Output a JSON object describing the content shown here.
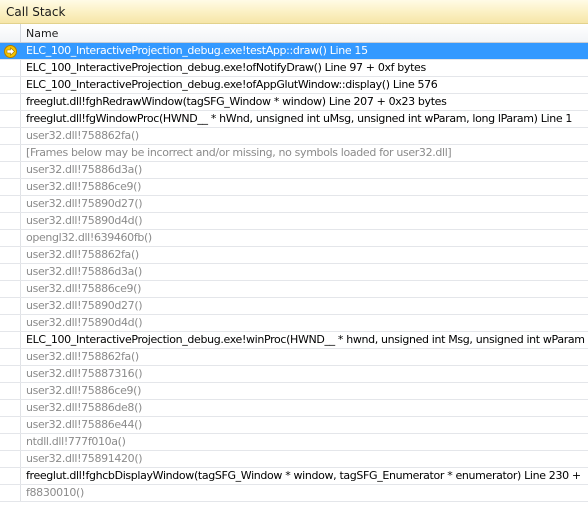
{
  "panel": {
    "title": "Call Stack"
  },
  "columns": {
    "name": "Name"
  },
  "icons": {
    "current_frame": "current-frame-arrow-icon"
  },
  "colors": {
    "selection": "#3399ff",
    "user_code": "#000000",
    "external_code": "#8b8b8b"
  },
  "frames": [
    {
      "text": "ELC_100_InteractiveProjection_debug.exe!testApp::draw()  Line 15",
      "kind": "user",
      "current": true
    },
    {
      "text": "ELC_100_InteractiveProjection_debug.exe!ofNotifyDraw()  Line 97 + 0xf bytes",
      "kind": "user",
      "current": false
    },
    {
      "text": "ELC_100_InteractiveProjection_debug.exe!ofAppGlutWindow::display()  Line 576",
      "kind": "user",
      "current": false
    },
    {
      "text": "freeglut.dll!fghRedrawWindow(tagSFG_Window * window)  Line 207 + 0x23 bytes",
      "kind": "user",
      "current": false
    },
    {
      "text": "freeglut.dll!fgWindowProc(HWND__ * hWnd, unsigned int uMsg, unsigned int wParam, long lParam)  Line 1",
      "kind": "user",
      "current": false
    },
    {
      "text": "user32.dll!758862fa()",
      "kind": "external",
      "current": false
    },
    {
      "text": "[Frames below may be incorrect and/or missing, no symbols loaded for user32.dll]",
      "kind": "external",
      "current": false
    },
    {
      "text": "user32.dll!75886d3a()",
      "kind": "external",
      "current": false
    },
    {
      "text": "user32.dll!75886ce9()",
      "kind": "external",
      "current": false
    },
    {
      "text": "user32.dll!75890d27()",
      "kind": "external",
      "current": false
    },
    {
      "text": "user32.dll!75890d4d()",
      "kind": "external",
      "current": false
    },
    {
      "text": "opengl32.dll!639460fb()",
      "kind": "external",
      "current": false
    },
    {
      "text": "user32.dll!758862fa()",
      "kind": "external",
      "current": false
    },
    {
      "text": "user32.dll!75886d3a()",
      "kind": "external",
      "current": false
    },
    {
      "text": "user32.dll!75886ce9()",
      "kind": "external",
      "current": false
    },
    {
      "text": "user32.dll!75890d27()",
      "kind": "external",
      "current": false
    },
    {
      "text": "user32.dll!75890d4d()",
      "kind": "external",
      "current": false
    },
    {
      "text": "ELC_100_InteractiveProjection_debug.exe!winProc(HWND__ * hwnd, unsigned int Msg, unsigned int wParam",
      "kind": "user",
      "current": false
    },
    {
      "text": "user32.dll!758862fa()",
      "kind": "external",
      "current": false
    },
    {
      "text": "user32.dll!75887316()",
      "kind": "external",
      "current": false
    },
    {
      "text": "user32.dll!75886ce9()",
      "kind": "external",
      "current": false
    },
    {
      "text": "user32.dll!75886de8()",
      "kind": "external",
      "current": false
    },
    {
      "text": "user32.dll!75886e44()",
      "kind": "external",
      "current": false
    },
    {
      "text": "ntdll.dll!777f010a()",
      "kind": "external",
      "current": false
    },
    {
      "text": "user32.dll!75891420()",
      "kind": "external",
      "current": false
    },
    {
      "text": "freeglut.dll!fghcbDisplayWindow(tagSFG_Window * window, tagSFG_Enumerator * enumerator)  Line 230 +",
      "kind": "user",
      "current": false
    },
    {
      "text": "f8830010()",
      "kind": "external",
      "current": false
    }
  ]
}
